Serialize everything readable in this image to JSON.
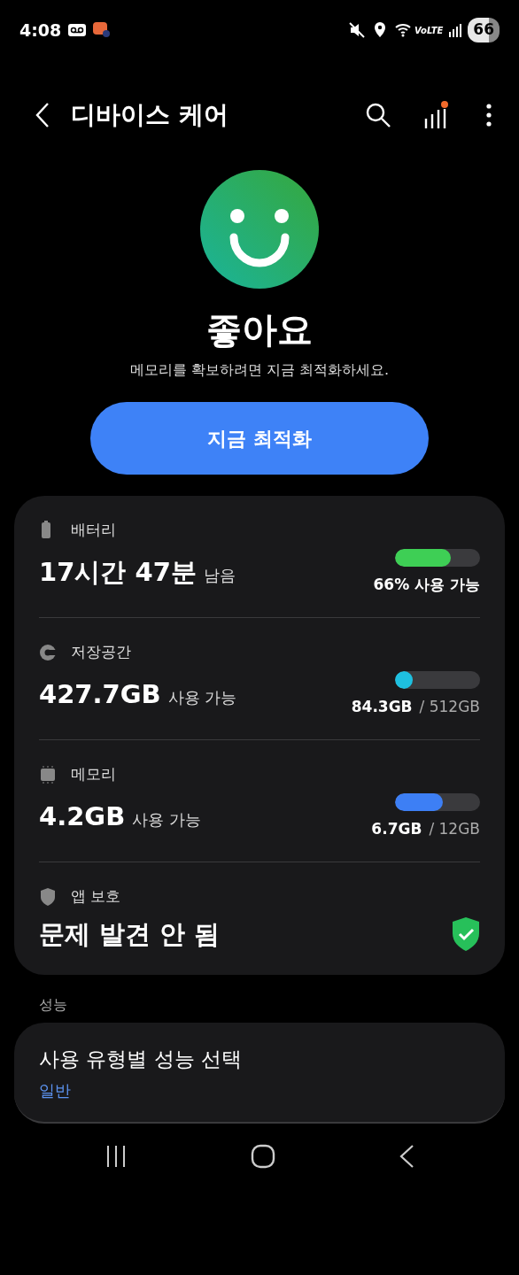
{
  "status_bar": {
    "time": "4:08",
    "network": "VoLTE",
    "battery": "66"
  },
  "header": {
    "title": "디바이스 케어",
    "notification_dot": true
  },
  "summary": {
    "status": "좋아요",
    "message": "메모리를 확보하려면 지금 최적화하세요.",
    "button": "지금 최적화"
  },
  "items": [
    {
      "kind": "meter",
      "label": "배터리",
      "value": "17시간 47분",
      "suffix": "남음",
      "level": 0.66,
      "color": "#3ecf55",
      "reading": "66% 사용 가능"
    },
    {
      "kind": "meter",
      "label": "저장공간",
      "value": "427.7GB",
      "suffix": "사용 가능",
      "level": 0.16,
      "color": "#1ec0e0",
      "reading": "84.3GB",
      "total": "/ 512GB"
    },
    {
      "kind": "meter",
      "label": "메모리",
      "value": "4.2GB",
      "suffix": "사용 가능",
      "level": 0.56,
      "color": "#3d7ff5",
      "reading": "6.7GB",
      "total": "/ 12GB"
    },
    {
      "kind": "status",
      "label": "앱 보호",
      "value": "문제 발견 안 됨"
    }
  ],
  "performance": {
    "section": "성능",
    "title": "사용 유형별 성능 선택",
    "value": "일반"
  }
}
